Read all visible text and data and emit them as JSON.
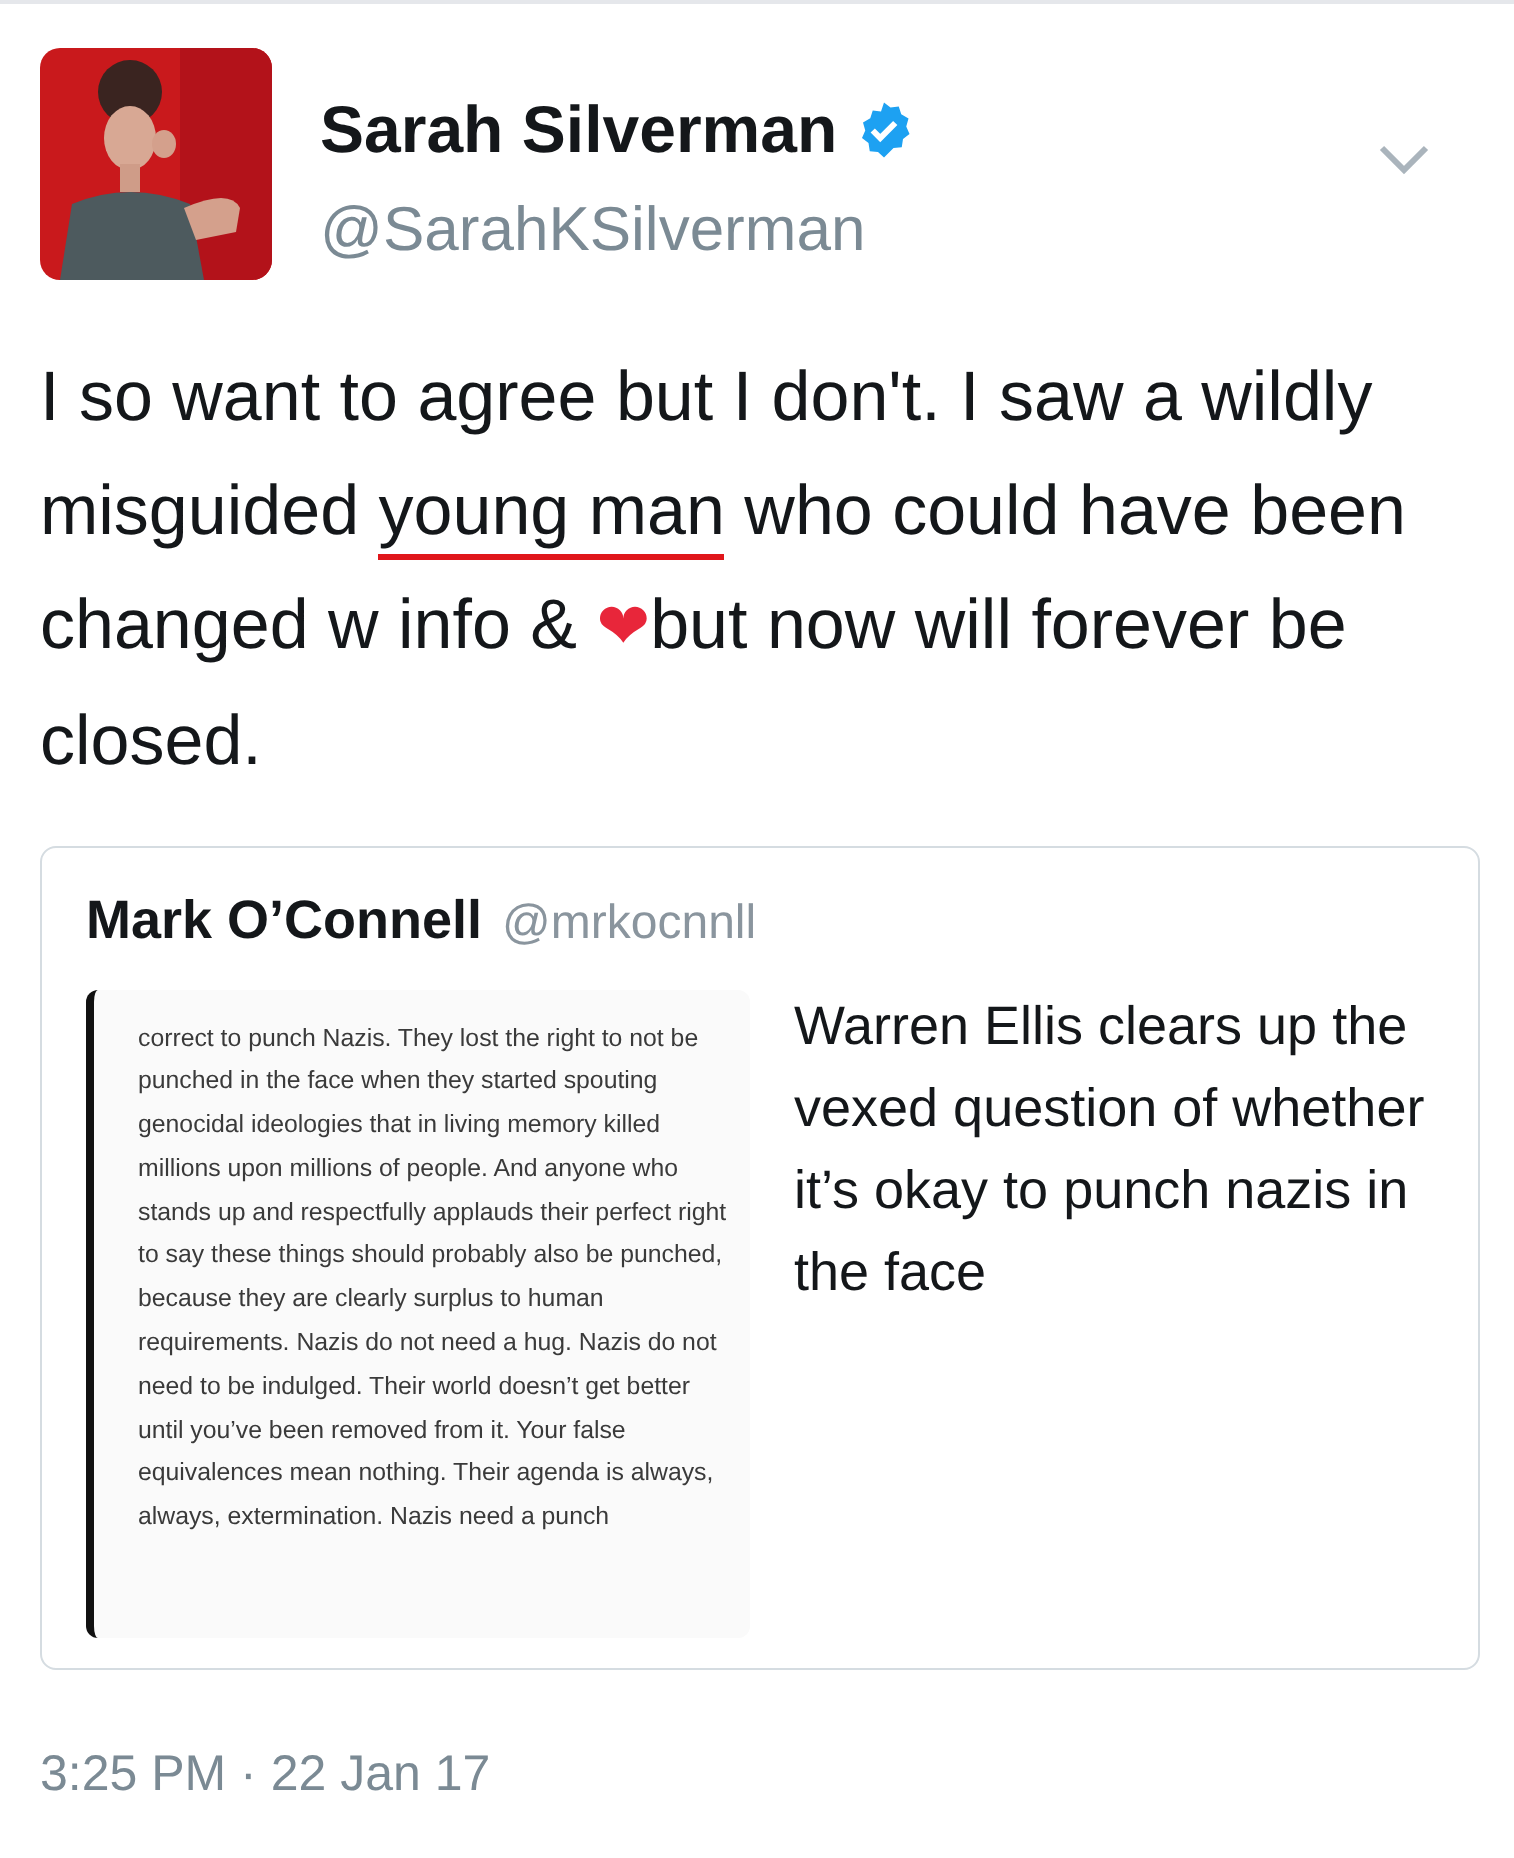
{
  "author": {
    "name": "Sarah Silverman",
    "verified": true,
    "handle": "@SarahKSilverman"
  },
  "body": [
    {
      "kind": "text",
      "text": "I so want to agree but I don't. I saw a wildly misguided "
    },
    {
      "kind": "underlined",
      "text": "young man"
    },
    {
      "kind": "text",
      "text": " who could have been changed w info & "
    },
    {
      "kind": "emoji",
      "text": "❤"
    },
    {
      "kind": "text",
      "text": "but now will forever be closed."
    }
  ],
  "quote": {
    "name": "Mark O’Connell",
    "handle": "@mrkocnnll",
    "document": "correct to punch Nazis. They lost the right to not be punched in the face when they started spouting genocidal ideologies that in living memory killed millions upon millions of people. And anyone who stands up and respectfully applauds their perfect right to say these things should probably also be punched, because they are clearly surplus to human requirements. Nazis do not need a hug. Nazis do not need to be indulged. Their world doesn’t get better until you’ve been removed from it. Your false equivalences mean nothing. Their agenda is always, always, extermination. Nazis need a punch",
    "text": "Warren Ellis clears up the vexed question of whether it’s okay to punch nazis in the face"
  },
  "timestamp": "3:25 PM · 22 Jan 17"
}
